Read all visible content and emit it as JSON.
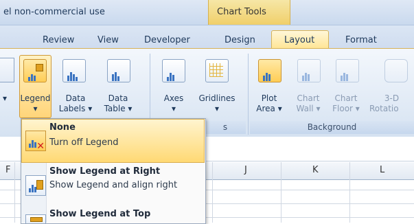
{
  "window": {
    "title_fragment": "el non-commercial use",
    "context_tab": "Chart Tools"
  },
  "tabs": [
    {
      "label": "Review"
    },
    {
      "label": "View"
    },
    {
      "label": "Developer"
    },
    {
      "label": "Design"
    },
    {
      "label": "Layout",
      "active": true
    },
    {
      "label": "Format"
    }
  ],
  "ribbon": {
    "legend": {
      "line1": "Legend",
      "arrow": "▾"
    },
    "data_labels": {
      "line1": "Data",
      "line2": "Labels ▾"
    },
    "data_table": {
      "line1": "Data",
      "line2": "Table ▾"
    },
    "axes": {
      "line1": "Axes",
      "arrow": "▾"
    },
    "gridlines": {
      "line1": "Gridlines",
      "arrow": "▾"
    },
    "plot_area": {
      "line1": "Plot",
      "line2": "Area ▾"
    },
    "chart_wall": {
      "line1": "Chart",
      "line2": "Wall ▾"
    },
    "chart_floor": {
      "line1": "Chart",
      "line2": "Floor ▾"
    },
    "rotation_3d": {
      "line1": "3-D",
      "line2": "Rotatio"
    },
    "left_arrow": "▾",
    "group_axes_tail": "s",
    "group_background": "Background"
  },
  "columns": [
    "F",
    "J",
    "K",
    "L"
  ],
  "legend_menu": [
    {
      "title": "None",
      "desc": "Turn off Legend",
      "selected": true
    },
    {
      "title": "Show Legend at Right",
      "desc": "Show Legend and align right"
    },
    {
      "title": "Show Legend at Top",
      "desc": ""
    }
  ],
  "colors": {
    "accent": "#ffd974",
    "ribbon": "#dfe9f5",
    "text": "#1e395b"
  }
}
